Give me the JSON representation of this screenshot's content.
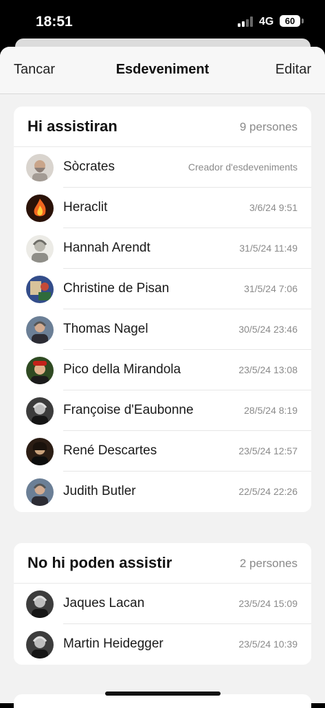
{
  "status_bar": {
    "time": "18:51",
    "network": "4G",
    "battery": "60"
  },
  "nav": {
    "left": "Tancar",
    "title": "Esdeveniment",
    "right": "Editar"
  },
  "attending": {
    "title": "Hi assistiran",
    "count": "9 persones",
    "people": [
      {
        "name": "Sòcrates",
        "meta": "Creador d'esdeveniments",
        "icon": "socrates-avatar-icon"
      },
      {
        "name": "Heraclit",
        "meta": "3/6/24 9:51",
        "icon": "fire-avatar-icon"
      },
      {
        "name": "Hannah Arendt",
        "meta": "31/5/24 11:49",
        "icon": "portrait-sketch-avatar-icon"
      },
      {
        "name": "Christine de Pisan",
        "meta": "31/5/24 7:06",
        "icon": "manuscript-avatar-icon"
      },
      {
        "name": "Thomas Nagel",
        "meta": "30/5/24 23:46",
        "icon": "portrait-avatar-icon"
      },
      {
        "name": "Pico della Mirandola",
        "meta": "23/5/24 13:08",
        "icon": "painting-avatar-icon"
      },
      {
        "name": "Françoise d'Eaubonne",
        "meta": "28/5/24 8:19",
        "icon": "bw-portrait-avatar-icon"
      },
      {
        "name": "René Descartes",
        "meta": "23/5/24 12:57",
        "icon": "painted-portrait-avatar-icon"
      },
      {
        "name": "Judith Butler",
        "meta": "22/5/24 22:26",
        "icon": "portrait-avatar-icon"
      }
    ]
  },
  "declined": {
    "title": "No hi poden assistir",
    "count": "2 persones",
    "people": [
      {
        "name": "Jaques Lacan",
        "meta": "23/5/24 15:09",
        "icon": "bw-portrait-avatar-icon"
      },
      {
        "name": "Martin Heidegger",
        "meta": "23/5/24 10:39",
        "icon": "bw-portrait-avatar-icon"
      }
    ]
  },
  "colors": {
    "accent": "#222222",
    "background": "#f2f2f2",
    "card": "#ffffff",
    "secondary_text": "#8a8a8a"
  }
}
